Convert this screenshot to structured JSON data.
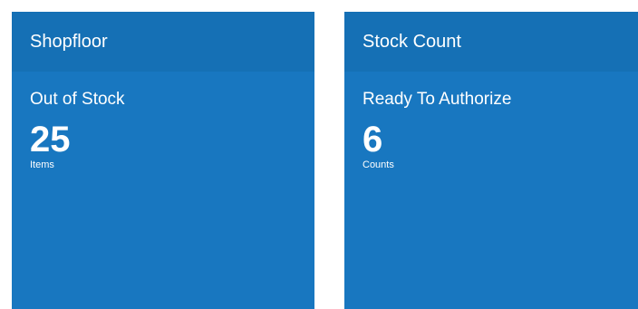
{
  "tiles": [
    {
      "title": "Shopfloor",
      "subtitle": "Out of Stock",
      "value": "25",
      "unit": "Items"
    },
    {
      "title": "Stock Count",
      "subtitle": "Ready To Authorize",
      "value": "6",
      "unit": "Counts"
    }
  ],
  "colors": {
    "tile_background": "#1877c0",
    "tile_header": "#1570b5",
    "text": "#ffffff"
  }
}
